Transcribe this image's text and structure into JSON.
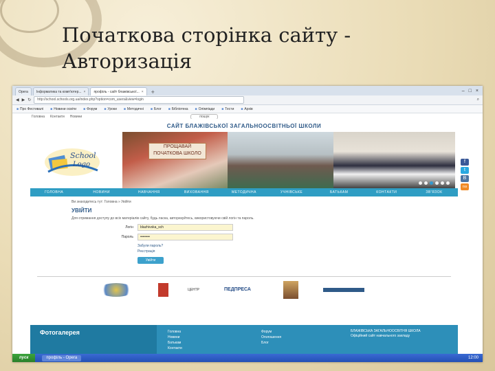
{
  "slide": {
    "title_line1": "Початкова сторінка сайту -",
    "title_line2": "Авторизація"
  },
  "browser": {
    "tabs": [
      {
        "label": "Opera",
        "active": false
      },
      {
        "label": "Інформатика та комп'ютер...",
        "active": false
      },
      {
        "label": "профіль - сайт блажівської...",
        "active": true
      }
    ],
    "url": "http://school.schools.org.ua/index.php?option=com_users&view=login",
    "bookmarks": [
      "Про Фестивалі",
      "Новини освіти",
      "Форум",
      "Уроки",
      "Методичні",
      "Блог",
      "Бібліотека",
      "Олімпіади",
      "Тести",
      "Архів"
    ],
    "bookmarks2": [
      "Головна",
      "Контакти",
      "Новини"
    ],
    "search_placeholder": "пошук"
  },
  "site": {
    "title": "САЙТ БЛАЖІВСЬКОЇ ЗАГАЛЬНООСВІТНЬОЇ ШКОЛИ",
    "logo_text": "School Logo",
    "photo_sign": "ПРОЩАВАЙ ПОЧАТКОВА ШКОЛО",
    "nav": [
      "ГОЛОВНА",
      "НОВИНИ",
      "НАВЧАННЯ",
      "ВИХОВАННЯ",
      "МЕТОДИЧНА",
      "УЧНІВСЬКЕ",
      "БАТЬКАМ",
      "КОНТАКТИ",
      "ЗВ'ЯЗОК"
    ],
    "social": [
      "f",
      "t",
      "В",
      "rss"
    ],
    "breadcrumb": "Ви знаходитесь тут: Головна » Увійти",
    "login_heading": "УВІЙТИ",
    "login_text": "Для отримання доступу до всіх матеріалів сайту, будь ласка, авторизуйтесь, використовуючи свій логін та пароль.",
    "login_label": "Логін",
    "login_value": "blazhivska_sch",
    "password_label": "Пароль",
    "password_value": "••••••••",
    "forgot_password": "Забули пароль?",
    "register": "Реєстрація",
    "submit": "Увійти",
    "partners": [
      "Освіта",
      "ЦЕНТР",
      "ПЕДПРЕСА"
    ],
    "footer": {
      "gallery": "Фотогалерея",
      "col1": [
        "Головна",
        "Новини",
        "Батькам",
        "Контакти"
      ],
      "col2": [
        "Форум",
        "Оголошення",
        "Блог"
      ],
      "blazh_title": "БЛАЖІВСЬКА ЗАГАЛЬНООСВІТНЯ ШКОЛА",
      "blazh_text": "Офіційний сайт навчального закладу"
    }
  },
  "taskbar": {
    "start": "пуск",
    "task": "профіль - Opera",
    "clock": "12:00"
  }
}
